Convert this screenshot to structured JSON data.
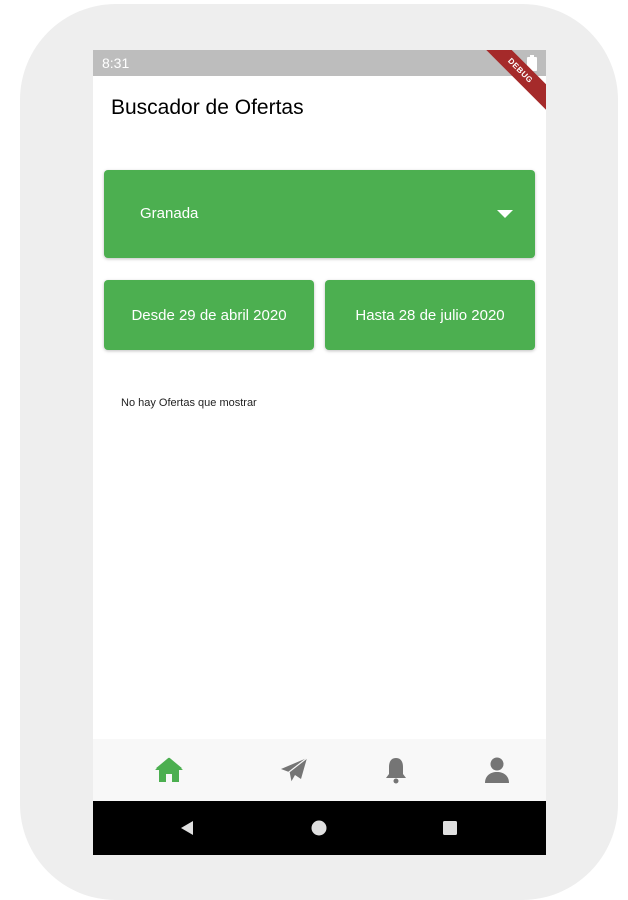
{
  "status_bar": {
    "time": "8:31",
    "debug_label": "DEBUG"
  },
  "app_bar": {
    "title": "Buscador de Ofertas"
  },
  "city_select": {
    "selected": "Granada",
    "icon": "dropdown-arrow-icon"
  },
  "dates": {
    "from_label": "Desde 29 de abril 2020",
    "to_label": "Hasta 28 de julio 2020"
  },
  "results": {
    "empty_message": "No hay Ofertas que mostrar"
  },
  "bottom_nav": {
    "active": "home",
    "items": [
      {
        "id": "home",
        "icon": "home-icon",
        "color": "#4caf50"
      },
      {
        "id": "send",
        "icon": "paper-plane-icon",
        "color": "#757575"
      },
      {
        "id": "alerts",
        "icon": "bell-icon",
        "color": "#757575"
      },
      {
        "id": "profile",
        "icon": "user-icon",
        "color": "#757575"
      }
    ]
  },
  "system_nav": {
    "icons": [
      "back-triangle-icon",
      "home-circle-icon",
      "recents-square-icon"
    ]
  },
  "colors": {
    "accent": "#4caf50",
    "status_bar": "#bdbdbd",
    "debug": "#a52a2a",
    "nav_inactive": "#757575"
  }
}
